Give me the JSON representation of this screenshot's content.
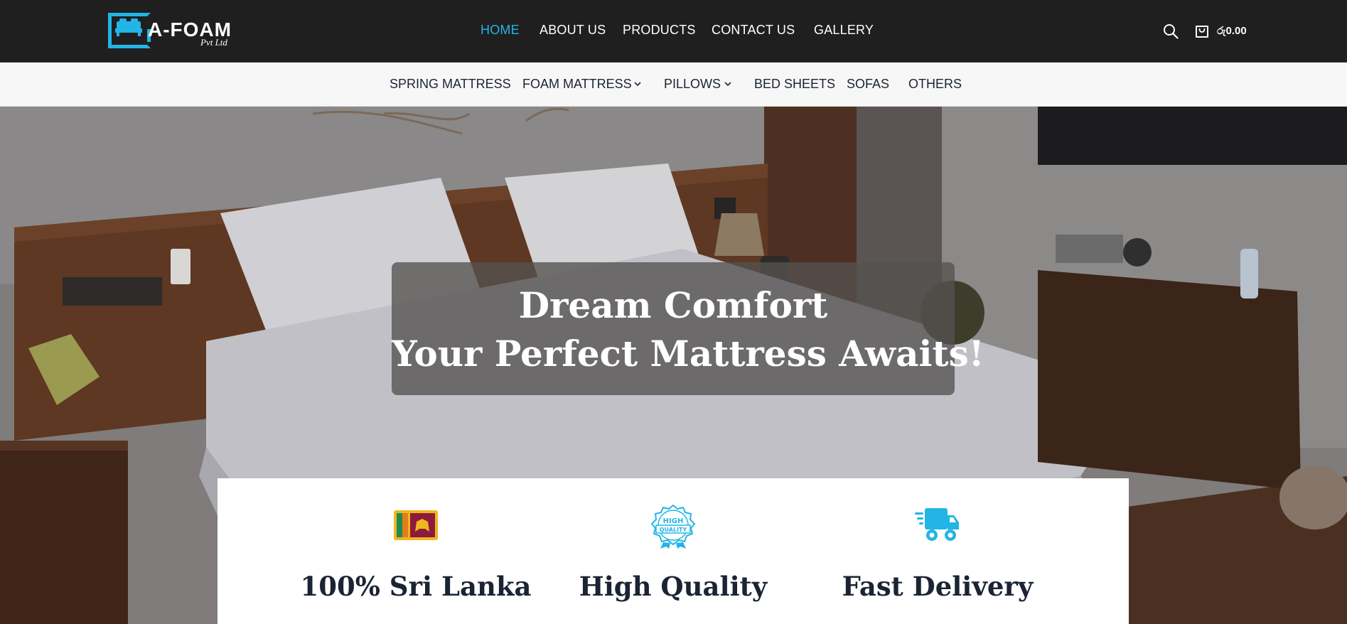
{
  "brand": {
    "name": "A-FOAM",
    "subtitle": "Pvt Ltd"
  },
  "main_nav": {
    "items": [
      {
        "label": "HOME",
        "active": true
      },
      {
        "label": "ABOUT US",
        "active": false
      },
      {
        "label": "PRODUCTS",
        "active": false
      },
      {
        "label": "CONTACT US",
        "active": false
      },
      {
        "label": "GALLERY",
        "active": false
      }
    ]
  },
  "header_actions": {
    "search_icon": "search-icon",
    "cart_icon": "shopping-bag-icon",
    "cart_total": "රු0.00"
  },
  "sub_nav": {
    "items": [
      {
        "label": "SPRING MATTRESS",
        "dropdown": false
      },
      {
        "label": "FOAM MATTRESS",
        "dropdown": true
      },
      {
        "label": "PILLOWS",
        "dropdown": true
      },
      {
        "label": "BED SHEETS",
        "dropdown": false
      },
      {
        "label": "SOFAS",
        "dropdown": false
      },
      {
        "label": "OTHERS",
        "dropdown": false
      }
    ]
  },
  "hero": {
    "line1": "Dream Comfort",
    "line2": "Your Perfect Mattress Awaits!"
  },
  "features": [
    {
      "icon": "sri-lanka-flag-icon",
      "title": "100% Sri Lanka"
    },
    {
      "icon": "high-quality-badge-icon",
      "title": "High Quality",
      "badge_top": "HIGH",
      "badge_bottom": "QUALITY"
    },
    {
      "icon": "delivery-truck-icon",
      "title": "Fast Delivery"
    }
  ],
  "colors": {
    "accent": "#22b5e6",
    "header_bg": "#1f1f1f",
    "subnav_bg": "#f7f7f7",
    "text_dark": "#1b2433"
  }
}
